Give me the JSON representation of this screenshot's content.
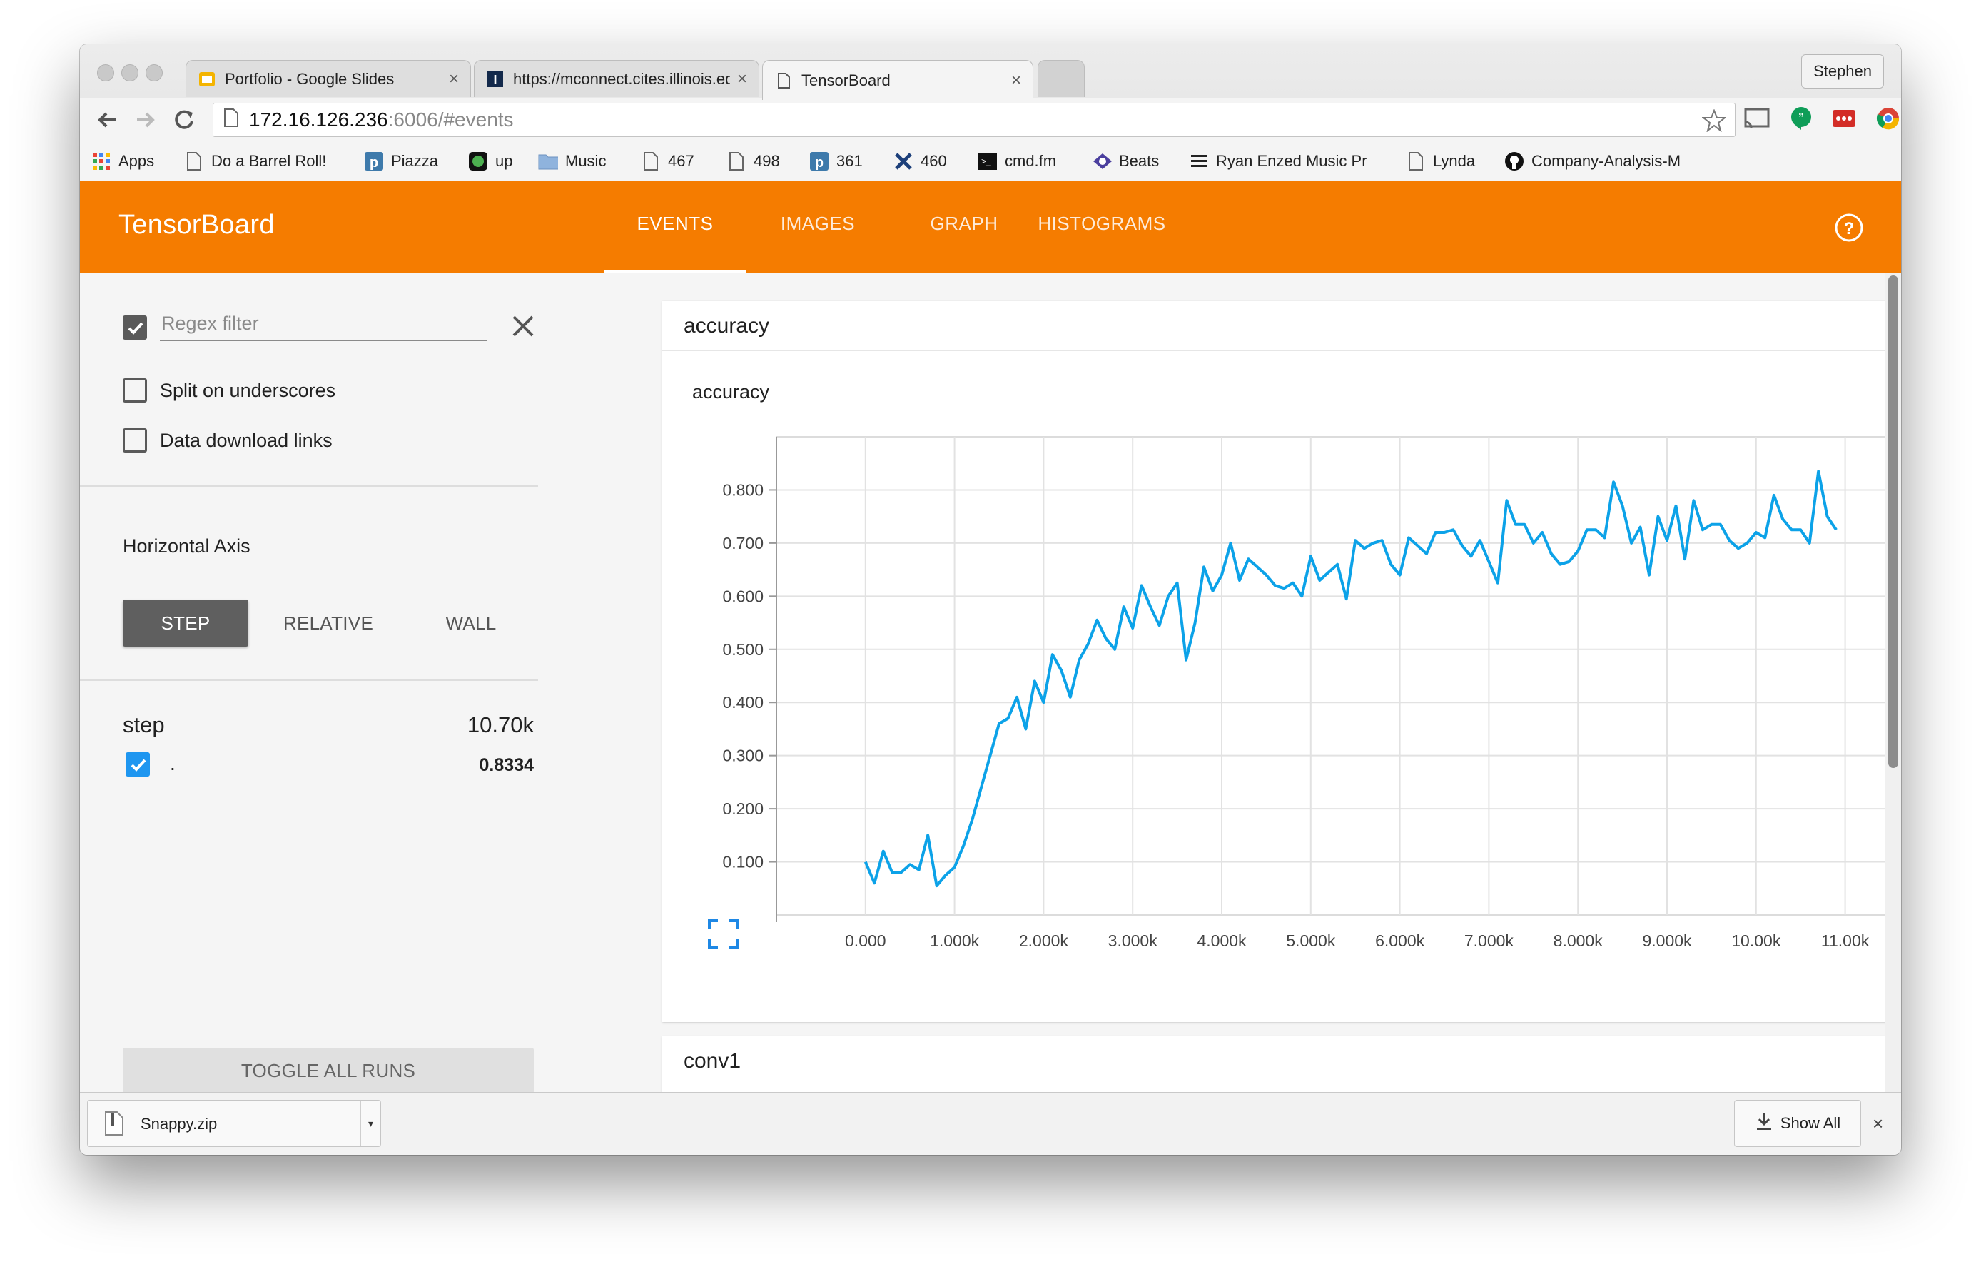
{
  "browser": {
    "tabs": [
      {
        "title": "Portfolio - Google Slides",
        "close": "×"
      },
      {
        "title": "https://mconnect.cites.illinois.edu",
        "close": "×"
      },
      {
        "title": "TensorBoard",
        "close": "×"
      }
    ],
    "user": "Stephen",
    "url": {
      "host": "172.16.126.236",
      "rest": ":6006/#events"
    },
    "bookmarks": [
      {
        "label": "Apps",
        "icon": "apps-grid-icon"
      },
      {
        "label": "Do a Barrel Roll!",
        "icon": "page-icon"
      },
      {
        "label": "Piazza",
        "icon": "piazza-icon"
      },
      {
        "label": "up",
        "icon": "up-icon"
      },
      {
        "label": "Music",
        "icon": "folder-icon"
      },
      {
        "label": "467",
        "icon": "page-icon"
      },
      {
        "label": "498",
        "icon": "page-icon"
      },
      {
        "label": "361",
        "icon": "piazza-icon"
      },
      {
        "label": "460",
        "icon": "x-icon"
      },
      {
        "label": "cmd.fm",
        "icon": "terminal-icon"
      },
      {
        "label": "Beats",
        "icon": "beats-icon"
      },
      {
        "label": "Ryan Enzed Music Pr",
        "icon": "menu-lines-icon"
      },
      {
        "label": "Lynda",
        "icon": "page-icon"
      },
      {
        "label": "Company-Analysis-M",
        "icon": "github-icon"
      }
    ]
  },
  "app": {
    "title": "TensorBoard",
    "tabs": [
      {
        "label": "EVENTS",
        "active": true
      },
      {
        "label": "IMAGES",
        "active": false
      },
      {
        "label": "GRAPH",
        "active": false
      },
      {
        "label": "HISTOGRAMS",
        "active": false
      }
    ],
    "accent_color": "#f57c00"
  },
  "sidebar": {
    "regex_checkbox_checked": true,
    "regex_placeholder": "Regex filter",
    "split_label": "Split on underscores",
    "split_checked": false,
    "download_label": "Data download links",
    "download_checked": false,
    "axis_title": "Horizontal Axis",
    "axis_options": [
      "STEP",
      "RELATIVE",
      "WALL"
    ],
    "axis_selected": "STEP",
    "run_header_label": "step",
    "run_header_value": "10.70k",
    "runs": [
      {
        "name": ".",
        "value": "0.8334",
        "checked": true,
        "color": "#1e96f0"
      }
    ],
    "toggle_all": "TOGGLE ALL RUNS"
  },
  "cards": [
    {
      "title": "accuracy",
      "count": "1"
    },
    {
      "title": "conv1",
      "count": "3"
    }
  ],
  "chart_data": {
    "type": "line",
    "title": "accuracy",
    "xlim": [
      -1000,
      11500
    ],
    "ylim": [
      0,
      0.9
    ],
    "x_ticks": [
      0,
      1000,
      2000,
      3000,
      4000,
      5000,
      6000,
      7000,
      8000,
      9000,
      10000,
      11000
    ],
    "x_tick_labels": [
      "0.000",
      "1.000k",
      "2.000k",
      "3.000k",
      "4.000k",
      "5.000k",
      "6.000k",
      "7.000k",
      "8.000k",
      "9.000k",
      "10.00k",
      "11.00k"
    ],
    "y_ticks": [
      0.1,
      0.2,
      0.3,
      0.4,
      0.5,
      0.6,
      0.7,
      0.8
    ],
    "y_tick_labels": [
      "0.100",
      "0.200",
      "0.300",
      "0.400",
      "0.500",
      "0.600",
      "0.700",
      "0.800"
    ],
    "grid": true,
    "series": [
      {
        "color": "#0ca2e8",
        "x": [
          0,
          100,
          200,
          300,
          400,
          500,
          600,
          700,
          800,
          900,
          1000,
          1100,
          1200,
          1300,
          1400,
          1500,
          1600,
          1700,
          1800,
          1900,
          2000,
          2100,
          2200,
          2300,
          2400,
          2500,
          2600,
          2700,
          2800,
          2900,
          3000,
          3100,
          3200,
          3300,
          3400,
          3500,
          3600,
          3700,
          3800,
          3900,
          4000,
          4100,
          4200,
          4300,
          4400,
          4500,
          4600,
          4700,
          4800,
          4900,
          5000,
          5100,
          5200,
          5300,
          5400,
          5500,
          5600,
          5700,
          5800,
          5900,
          6000,
          6100,
          6200,
          6300,
          6400,
          6500,
          6600,
          6700,
          6800,
          6900,
          7000,
          7100,
          7200,
          7300,
          7400,
          7500,
          7600,
          7700,
          7800,
          7900,
          8000,
          8100,
          8200,
          8300,
          8400,
          8500,
          8600,
          8700,
          8800,
          8900,
          9000,
          9100,
          9200,
          9300,
          9400,
          9500,
          9600,
          9700,
          9800,
          9900,
          10000,
          10100,
          10200,
          10300,
          10400,
          10500,
          10600,
          10700,
          10800,
          10900
        ],
        "y": [
          0.1,
          0.06,
          0.12,
          0.08,
          0.08,
          0.095,
          0.085,
          0.15,
          0.055,
          0.075,
          0.09,
          0.13,
          0.18,
          0.24,
          0.3,
          0.36,
          0.37,
          0.41,
          0.35,
          0.44,
          0.4,
          0.49,
          0.46,
          0.41,
          0.48,
          0.51,
          0.555,
          0.52,
          0.5,
          0.58,
          0.54,
          0.62,
          0.58,
          0.545,
          0.6,
          0.625,
          0.48,
          0.55,
          0.655,
          0.61,
          0.64,
          0.7,
          0.63,
          0.67,
          0.655,
          0.64,
          0.62,
          0.615,
          0.625,
          0.6,
          0.675,
          0.63,
          0.645,
          0.66,
          0.595,
          0.705,
          0.69,
          0.7,
          0.705,
          0.66,
          0.64,
          0.71,
          0.695,
          0.68,
          0.72,
          0.72,
          0.725,
          0.695,
          0.675,
          0.705,
          0.665,
          0.625,
          0.78,
          0.735,
          0.735,
          0.7,
          0.72,
          0.68,
          0.66,
          0.665,
          0.685,
          0.725,
          0.725,
          0.71,
          0.815,
          0.77,
          0.7,
          0.73,
          0.64,
          0.75,
          0.705,
          0.77,
          0.67,
          0.78,
          0.725,
          0.735,
          0.735,
          0.705,
          0.69,
          0.7,
          0.72,
          0.71,
          0.79,
          0.745,
          0.725,
          0.725,
          0.7,
          0.835,
          0.75,
          0.725
        ]
      }
    ]
  },
  "download": {
    "file": "Snappy.zip",
    "show_all": "Show All",
    "close": "×"
  }
}
